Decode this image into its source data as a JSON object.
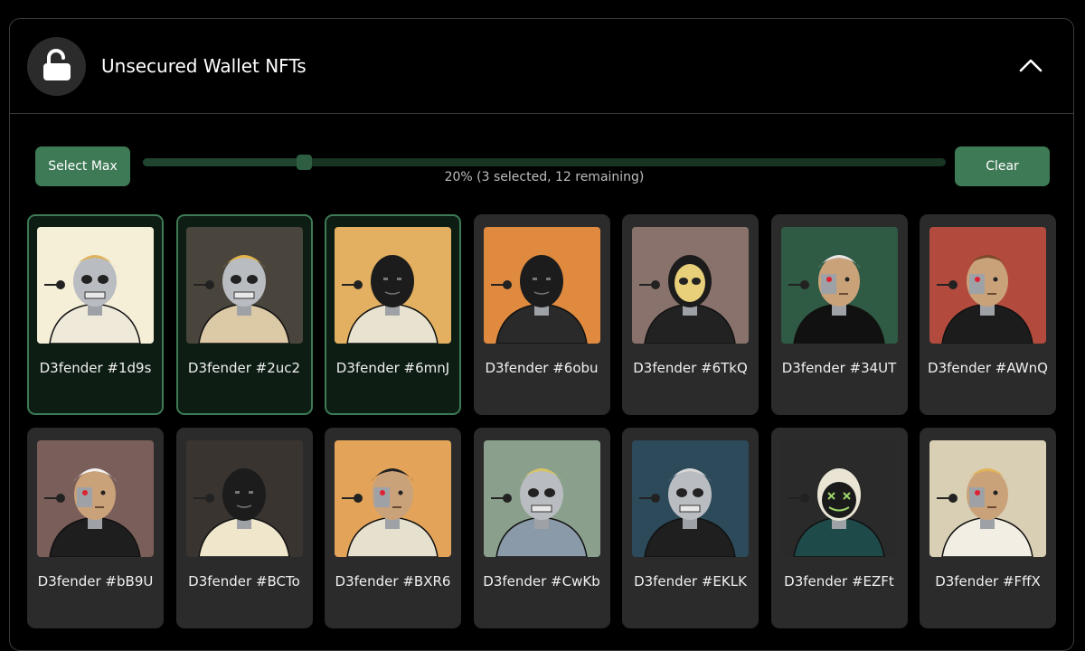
{
  "header": {
    "title": "Unsecured Wallet NFTs",
    "lock_icon": "unlocked-padlock-icon",
    "collapse_icon": "chevron-up-icon"
  },
  "controls": {
    "select_max_label": "Select Max",
    "clear_label": "Clear",
    "slider_value": 0.2,
    "slider_text": "20% (3 selected, 12 remaining)",
    "accent_color": "#3d7a55"
  },
  "nfts": [
    {
      "name": "D3fender #1d9s",
      "selected": true,
      "bg": "#f5efd8",
      "head": "skull",
      "hair": "#e0b25a",
      "jacket": "#efe9da"
    },
    {
      "name": "D3fender #2uc2",
      "selected": true,
      "bg": "#4a453c",
      "head": "skull",
      "hair": "#e4b44a",
      "jacket": "#dcc9a6"
    },
    {
      "name": "D3fender #6mnJ",
      "selected": true,
      "bg": "#e2b060",
      "head": "mask",
      "hair": null,
      "jacket": "#e8e2d0"
    },
    {
      "name": "D3fender #6obu",
      "selected": false,
      "bg": "#e08a40",
      "head": "mask",
      "hair": null,
      "jacket": "#2a2a2a"
    },
    {
      "name": "D3fender #6TkQ",
      "selected": false,
      "bg": "#8a726c",
      "head": "skullmask",
      "hair": null,
      "jacket": "#222222"
    },
    {
      "name": "D3fender #34UT",
      "selected": false,
      "bg": "#2f5a44",
      "head": "face",
      "hair": "#e8e8e8",
      "jacket": "#111111"
    },
    {
      "name": "D3fender #AWnQ",
      "selected": false,
      "bg": "#b24a3e",
      "head": "face",
      "hair": "#7a4a2a",
      "jacket": "#1c1c1c"
    },
    {
      "name": "D3fender #bB9U",
      "selected": false,
      "bg": "#7a5e5a",
      "head": "face",
      "hair": "#f2f2f2",
      "jacket": "#1e1e1e"
    },
    {
      "name": "D3fender #BCTo",
      "selected": false,
      "bg": "#3a3431",
      "head": "mask",
      "hair": null,
      "jacket": "#efe6cc"
    },
    {
      "name": "D3fender #BXR6",
      "selected": false,
      "bg": "#e3a45a",
      "head": "face",
      "hair": "#222222",
      "jacket": "#e6e0cf"
    },
    {
      "name": "D3fender #CwKb",
      "selected": false,
      "bg": "#8aa08c",
      "head": "skull",
      "hair": "#d8c468",
      "jacket": "#8a9aa8"
    },
    {
      "name": "D3fender #EKLK",
      "selected": false,
      "bg": "#2c4a5a",
      "head": "skull",
      "hair": "#d9d9d9",
      "jacket": "#1f1f1f"
    },
    {
      "name": "D3fender #EZFt",
      "selected": false,
      "bg": "#2a2a2a",
      "head": "xmask",
      "hair": null,
      "jacket": "#1f4a4a"
    },
    {
      "name": "D3fender #FffX",
      "selected": false,
      "bg": "#d9cfb4",
      "head": "face",
      "hair": "#e0b25a",
      "jacket": "#f2eee4"
    }
  ]
}
